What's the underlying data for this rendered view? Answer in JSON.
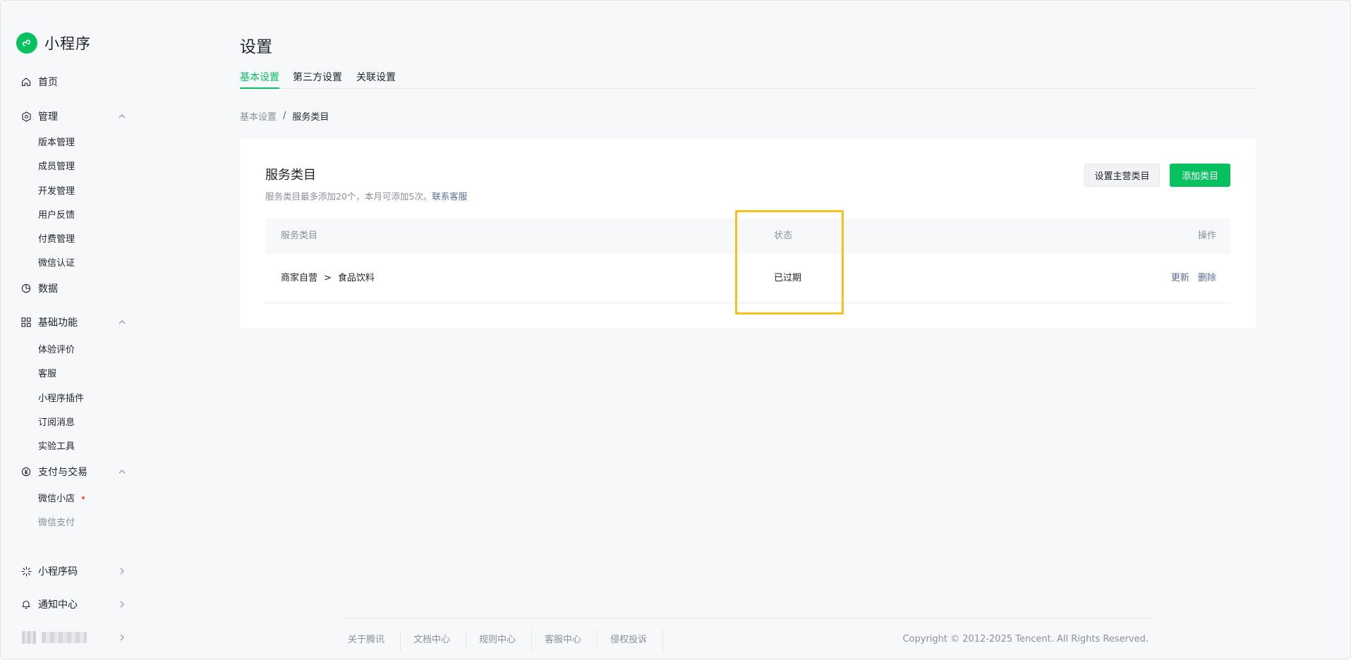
{
  "app": {
    "name": "小程序",
    "brand_color": "#07c160"
  },
  "sidebar": {
    "home": "首页",
    "manage": {
      "label": "管理",
      "items": [
        "版本管理",
        "成员管理",
        "开发管理",
        "用户反馈",
        "付费管理",
        "微信认证"
      ]
    },
    "data": "数据",
    "basic": {
      "label": "基础功能",
      "items": [
        "体验评价",
        "客服",
        "小程序插件",
        "订阅消息",
        "实验工具"
      ]
    },
    "pay": {
      "label": "支付与交易",
      "items": [
        "微信小店",
        "微信支付"
      ]
    },
    "qrcode": "小程序码",
    "notify": "通知中心"
  },
  "page": {
    "title": "设置"
  },
  "tabs": [
    "基本设置",
    "第三方设置",
    "关联设置"
  ],
  "breadcrumb": {
    "parent": "基本设置",
    "separator": "/",
    "current": "服务类目"
  },
  "card": {
    "title": "服务类目",
    "description": "服务类目最多添加20个，本月可添加5次。",
    "contact_link": "联系客服",
    "set_main_button": "设置主营类目",
    "add_button": "添加类目"
  },
  "table": {
    "headers": {
      "category": "服务类目",
      "status": "状态",
      "actions": "操作"
    },
    "rows": [
      {
        "category_parent": "商家自营",
        "arrow": ">",
        "category_child": "食品饮料",
        "status": "已过期",
        "action_update": "更新",
        "action_delete": "删除"
      }
    ]
  },
  "footer": {
    "links": [
      "关于腾讯",
      "文档中心",
      "规则中心",
      "客服中心",
      "侵权投诉"
    ],
    "copyright": "Copyright © 2012-2025 Tencent. All Rights Reserved."
  },
  "colors": {
    "accent": "#07c160",
    "link": "#576b95",
    "highlight": "#f6c01d"
  }
}
